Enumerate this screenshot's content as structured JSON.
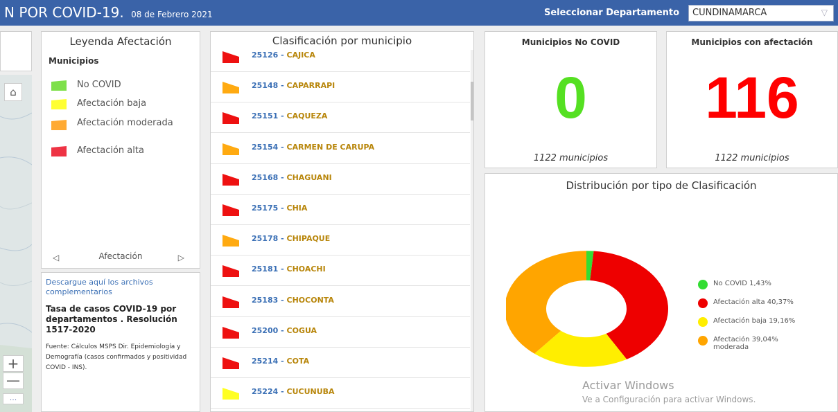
{
  "header": {
    "title": "N POR COVID-19.",
    "date": "08 de Febrero 2021",
    "dep_label": "Seleccionar Departamento",
    "dep_value": "CUNDINAMARCA",
    "bg_color": "#3a63a8"
  },
  "map": {
    "home_icon": "home-icon",
    "zoom_in": "+",
    "zoom_out": "—",
    "more": "..."
  },
  "legend": {
    "title": "Leyenda Afectación",
    "subtitle": "Municipios",
    "items": [
      {
        "label": "No COVID",
        "color": "#7ee04a"
      },
      {
        "label": "Afectación baja",
        "color": "#ffff33"
      },
      {
        "label": "Afectación moderada",
        "color": "#ffaa33"
      },
      {
        "label": "Afectación alta",
        "color": "#ee3344"
      }
    ],
    "nav_label": "Afectación",
    "prev": "◁",
    "next": "▷"
  },
  "info": {
    "link": "Descargue aquí los archivos complementarios",
    "tasa": "Tasa de casos COVID-19 por departamentos . Resolución 1517-2020",
    "fuente": "Fuente: Cálculos MSPS Dir. Epidemiología y Demografía (casos confirmados y positividad COVID - INS)."
  },
  "list": {
    "title": "Clasificación por municipio",
    "rows": [
      {
        "code": "25126",
        "name": "CAJICA",
        "color": "#ee1111"
      },
      {
        "code": "25148",
        "name": "CAPARRAPI",
        "color": "#ffaa11"
      },
      {
        "code": "25151",
        "name": "CAQUEZA",
        "color": "#ee1111"
      },
      {
        "code": "25154",
        "name": "CARMEN DE CARUPA",
        "color": "#ffaa11"
      },
      {
        "code": "25168",
        "name": "CHAGUANI",
        "color": "#ee1111"
      },
      {
        "code": "25175",
        "name": "CHIA",
        "color": "#ee1111"
      },
      {
        "code": "25178",
        "name": "CHIPAQUE",
        "color": "#ffaa11"
      },
      {
        "code": "25181",
        "name": "CHOACHI",
        "color": "#ee1111"
      },
      {
        "code": "25183",
        "name": "CHOCONTA",
        "color": "#ee1111"
      },
      {
        "code": "25200",
        "name": "COGUA",
        "color": "#ee1111"
      },
      {
        "code": "25214",
        "name": "COTA",
        "color": "#ee1111"
      },
      {
        "code": "25224",
        "name": "CUCUNUBA",
        "color": "#ffff22"
      }
    ]
  },
  "kpi_no_covid": {
    "title": "Municipios No COVID",
    "value": "0",
    "subtitle": "1122 municipios",
    "color": "#55e022"
  },
  "kpi_afectacion": {
    "title": "Municipios con afectación",
    "value": "116",
    "subtitle": "1122 municipios",
    "color": "#ff0000"
  },
  "chart_data": {
    "type": "pie",
    "title": "Distribución por tipo de Clasificación",
    "donut": true,
    "slices": [
      {
        "label": "No COVID",
        "value": 1.43,
        "display": "No COVID  1,43%",
        "color": "#33dd33"
      },
      {
        "label": "Afectación alta",
        "value": 40.37,
        "display": "Afectación alta  40,37%",
        "color": "#ee0000"
      },
      {
        "label": "Afectación baja",
        "value": 19.16,
        "display": "Afectación baja  19,16%",
        "color": "#ffee00"
      },
      {
        "label": "Afectación moderada",
        "value": 39.04,
        "display": "Afectación  39,04%\nmoderada",
        "color": "#ffa500"
      }
    ]
  },
  "watermark": {
    "line1": "Activar Windows",
    "line2": "Ve a Configuración para activar Windows."
  }
}
